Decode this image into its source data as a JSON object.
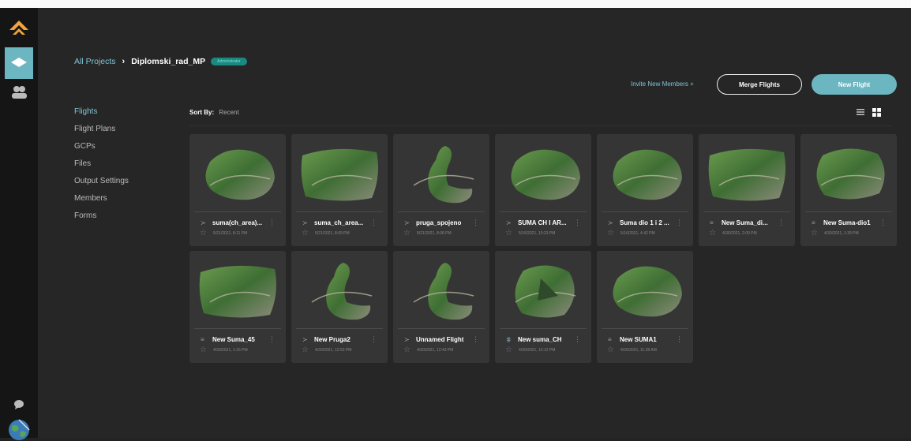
{
  "breadcrumb": {
    "root": "All Projects",
    "current": "Diplomski_rad_MP",
    "badge": "Administrator"
  },
  "actions": {
    "invite": "Invite New Members +",
    "merge": "Merge Flights",
    "new_flight": "New Flight"
  },
  "nav": [
    "Flights",
    "Flight Plans",
    "GCPs",
    "Files",
    "Output Settings",
    "Members",
    "Forms"
  ],
  "sort": {
    "label": "Sort By:",
    "value": "Recent"
  },
  "flights": [
    {
      "name": "suma(ch_area)...",
      "date": "5/21/2021, 8:11 PM",
      "type": "plan",
      "shape": "blob"
    },
    {
      "name": "suma_ch_area...",
      "date": "5/21/2021, 8:09 PM",
      "type": "plan",
      "shape": "wide"
    },
    {
      "name": "pruga_spojeno",
      "date": "5/21/2021, 8:08 PM",
      "type": "plan",
      "shape": "hook"
    },
    {
      "name": "SUMA CH I AR...",
      "date": "5/16/2021, 10:23 PM",
      "type": "plan",
      "shape": "blob"
    },
    {
      "name": "Suma dio 1 i 2 ...",
      "date": "5/16/2021, 4:42 PM",
      "type": "plan",
      "shape": "blob"
    },
    {
      "name": "New Suma_di...",
      "date": "4/30/2021, 2:00 PM",
      "type": "grid",
      "shape": "wide"
    },
    {
      "name": "New Suma-dio1",
      "date": "4/30/2021, 1:39 PM",
      "type": "grid",
      "shape": "round"
    },
    {
      "name": "New Suma_45",
      "date": "4/30/2021, 1:15 PM",
      "type": "grid",
      "shape": "wide"
    },
    {
      "name": "New Pruga2",
      "date": "4/30/2021, 12:53 PM",
      "type": "plan",
      "shape": "hook"
    },
    {
      "name": "Unnamed Flight",
      "date": "4/30/2021, 12:43 PM",
      "type": "plan",
      "shape": "hook"
    },
    {
      "name": "New suma_CH",
      "date": "4/30/2021, 12:12 PM",
      "type": "grid2",
      "shape": "tri"
    },
    {
      "name": "New SUMA1",
      "date": "4/30/2021, 11:28 AM",
      "type": "grid",
      "shape": "blob"
    }
  ],
  "icons": {
    "logo": "drone-logo-icon",
    "project": "layers-icon",
    "users": "users-icon",
    "chat": "chat-icon",
    "globe": "globe-icon",
    "list": "list-view-icon",
    "grid": "grid-view-icon",
    "star": "star-icon",
    "menu": "kebab-menu-icon"
  },
  "colors": {
    "accent": "#6cb6c2",
    "badge": "#1a8a80",
    "logo": "#f2a33c"
  }
}
